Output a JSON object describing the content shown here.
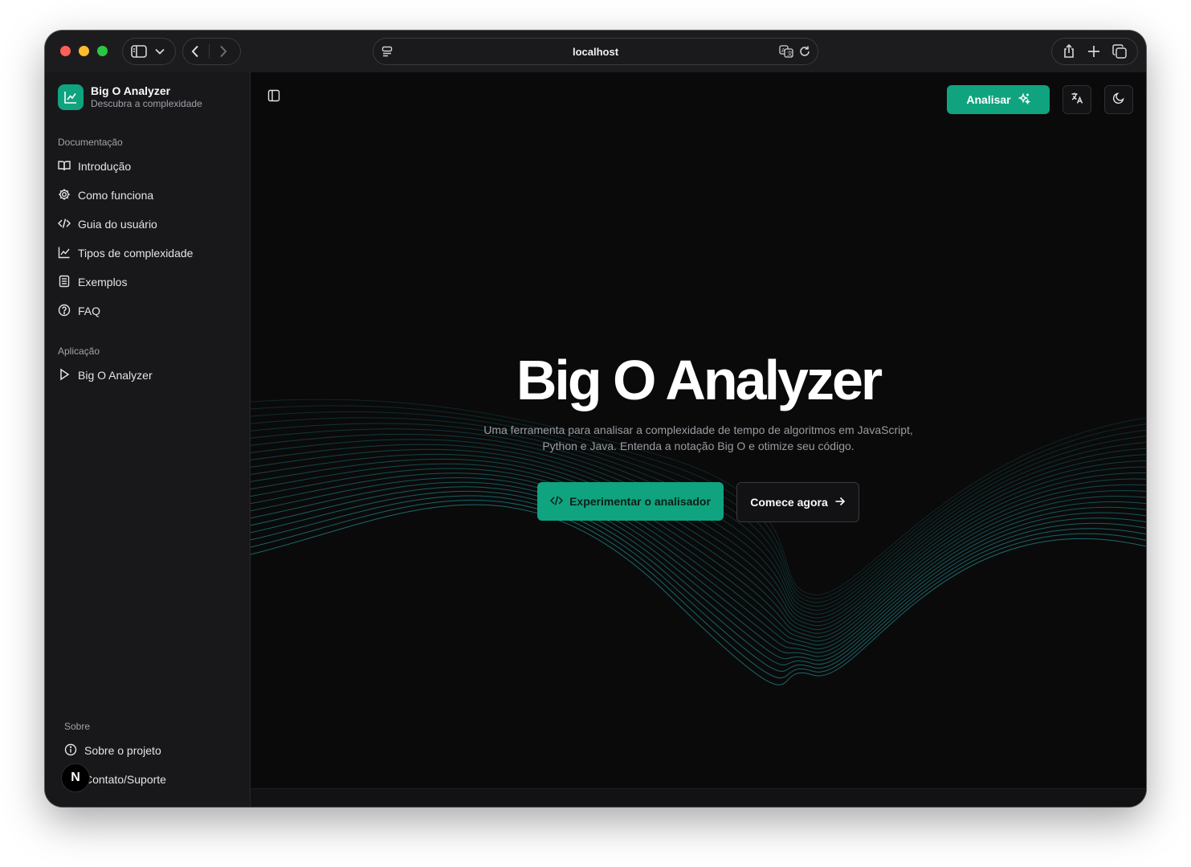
{
  "browser": {
    "url": "localhost"
  },
  "sidebar": {
    "brand_title": "Big O Analyzer",
    "brand_subtitle": "Descubra a complexidade",
    "groups": [
      {
        "label": "Documentação",
        "items": [
          {
            "label": "Introdução",
            "icon": "book-open-icon"
          },
          {
            "label": "Como funciona",
            "icon": "gear-icon"
          },
          {
            "label": "Guia do usuário",
            "icon": "code-icon"
          },
          {
            "label": "Tipos de complexidade",
            "icon": "line-chart-icon"
          },
          {
            "label": "Exemplos",
            "icon": "document-icon"
          },
          {
            "label": "FAQ",
            "icon": "help-circle-icon"
          }
        ]
      },
      {
        "label": "Aplicação",
        "items": [
          {
            "label": "Big O Analyzer",
            "icon": "play-icon"
          }
        ]
      },
      {
        "label": "Sobre",
        "items": [
          {
            "label": "Sobre o projeto",
            "icon": "info-icon"
          },
          {
            "label": "Contato/Suporte",
            "icon": "mail-icon"
          }
        ]
      }
    ],
    "badge_letter": "N"
  },
  "header": {
    "analyze_label": "Analisar"
  },
  "hero": {
    "title": "Big O Analyzer",
    "subtitle": "Uma ferramenta para analisar a complexidade de tempo de algoritmos em JavaScript, Python e Java. Entenda a notação Big O e otimize seu código.",
    "primary_cta": "Experimentar o analisador",
    "secondary_cta": "Comece agora"
  },
  "colors": {
    "accent": "#10a37f",
    "wave": "#1f7f86",
    "background": "#0a0a0a",
    "sidebar": "#18181b"
  }
}
